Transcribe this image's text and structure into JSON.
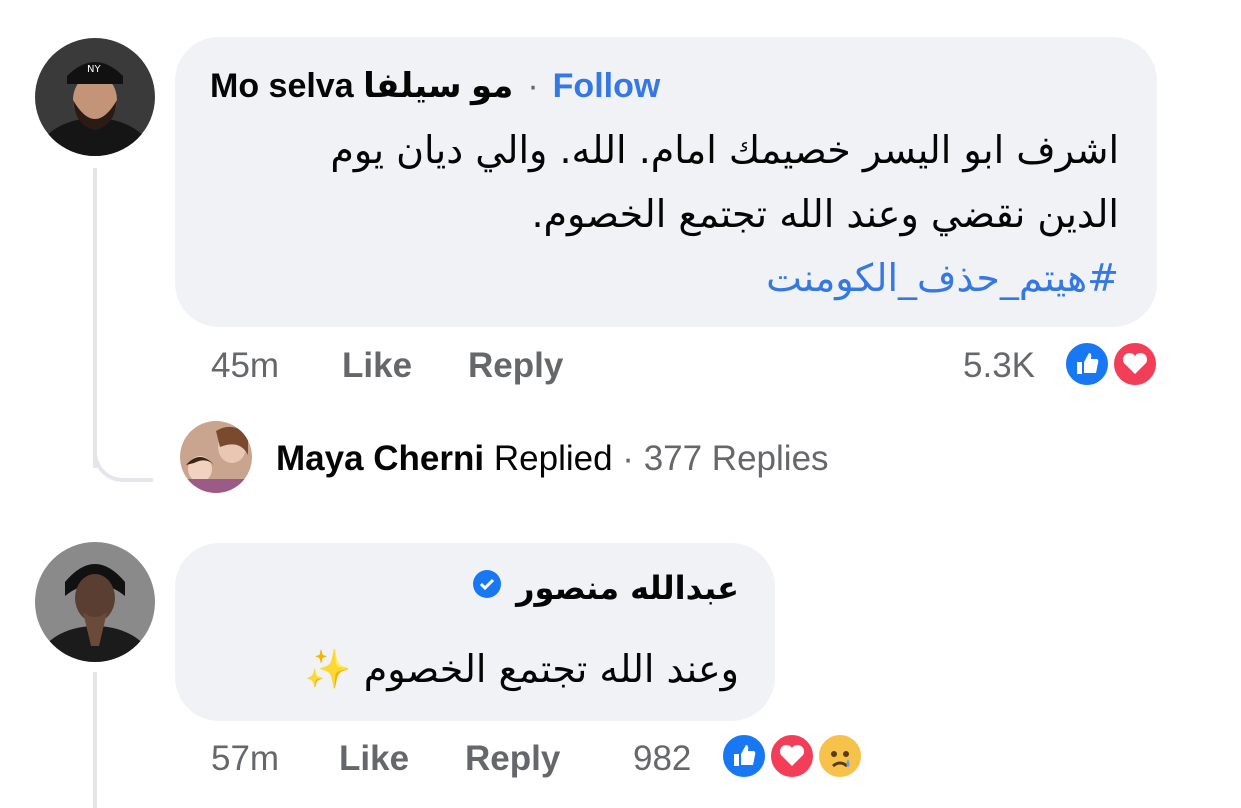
{
  "comments": [
    {
      "author": "Mo selva مو سيلفا",
      "follow_label": "Follow",
      "separator": "·",
      "lines": [
        "اشرف ابو اليسر خصيمك امام. الله.  والي ديان يوم",
        "الدين  نقضي وعند الله تجتمع الخصوم."
      ],
      "hashtag": "#هيتم_حذف_الكومنت",
      "time": "45m",
      "like_label": "Like",
      "reply_label": "Reply",
      "reaction_count": "5.3K",
      "reactions": [
        "like-icon",
        "love-icon"
      ]
    },
    {
      "author": "عبدالله  منصور",
      "verified": true,
      "lines": [
        "وعند الله تجتمع الخصوم"
      ],
      "emoji": "✨",
      "time": "57m",
      "like_label": "Like",
      "reply_label": "Reply",
      "reaction_count": "982",
      "reactions": [
        "like-icon",
        "love-icon",
        "sad-icon"
      ]
    }
  ],
  "replies_summary": {
    "name": "Maya Cherni",
    "action": "Replied",
    "separator": "·",
    "count": "377 Replies"
  },
  "colors": {
    "bubble": "#f0f2f5",
    "link": "#3578e5",
    "meta": "#65676b",
    "like": "#1877f2",
    "love": "#f33e58",
    "verified": "#1877f2"
  }
}
